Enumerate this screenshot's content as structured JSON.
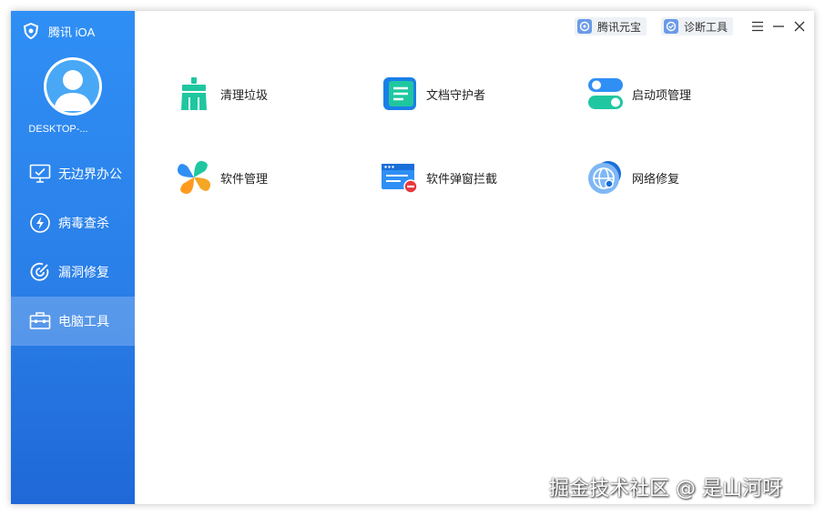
{
  "app": {
    "brand_name": "腾讯 iOA",
    "computer_name": "DESKTOP-..."
  },
  "sidebar": {
    "items": [
      {
        "label": "无边界办公",
        "icon": "monitor-check-icon",
        "active": false
      },
      {
        "label": "病毒查杀",
        "icon": "lightning-icon",
        "active": false
      },
      {
        "label": "漏洞修复",
        "icon": "target-icon",
        "active": false
      },
      {
        "label": "电脑工具",
        "icon": "toolbox-icon",
        "active": true
      }
    ]
  },
  "topbar": {
    "yuanbao_label": "腾讯元宝",
    "diagnose_label": "诊断工具"
  },
  "tools": [
    {
      "label": "清理垃圾",
      "icon": "broom-icon"
    },
    {
      "label": "文档守护者",
      "icon": "document-icon"
    },
    {
      "label": "启动项管理",
      "icon": "toggle-icon"
    },
    {
      "label": "软件管理",
      "icon": "clover-icon"
    },
    {
      "label": "软件弹窗拦截",
      "icon": "popup-block-icon"
    },
    {
      "label": "网络修复",
      "icon": "globe-icon"
    }
  ],
  "watermark": "掘金技术社区 @ 是山河呀",
  "colors": {
    "sidebar": "#2a7fe8",
    "accent_green": "#1fc7a0",
    "accent_blue": "#2f8ff5"
  }
}
